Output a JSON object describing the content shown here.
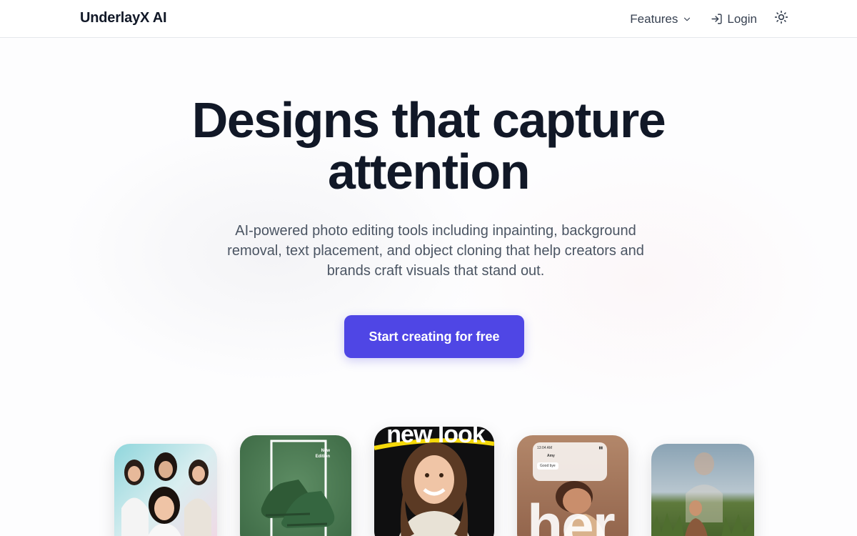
{
  "nav": {
    "brand": "UnderlayX AI",
    "features_label": "Features",
    "login_label": "Login"
  },
  "hero": {
    "title_line1": "Designs that capture",
    "title_line2": "attention",
    "subtitle": "AI-powered photo editing tools including inpainting, background removal, text placement, and object cloning that help creators and brands craft visuals that stand out.",
    "cta_label": "Start creating for free"
  },
  "cards": {
    "sneaker_edition": "New Edition",
    "portrait_text": "new look",
    "chat_time": "13:04 AM",
    "chat_name": "Amy",
    "chat_message": "Good bye",
    "silhouette_text": "her"
  },
  "colors": {
    "accent": "#4f46e5",
    "text_dark": "#111827",
    "text_muted": "#4b5563",
    "border": "#e5e7eb"
  },
  "icons": {
    "features_chevron": "chevron-down-icon",
    "login": "login-arrow-icon",
    "theme": "sun-icon"
  }
}
